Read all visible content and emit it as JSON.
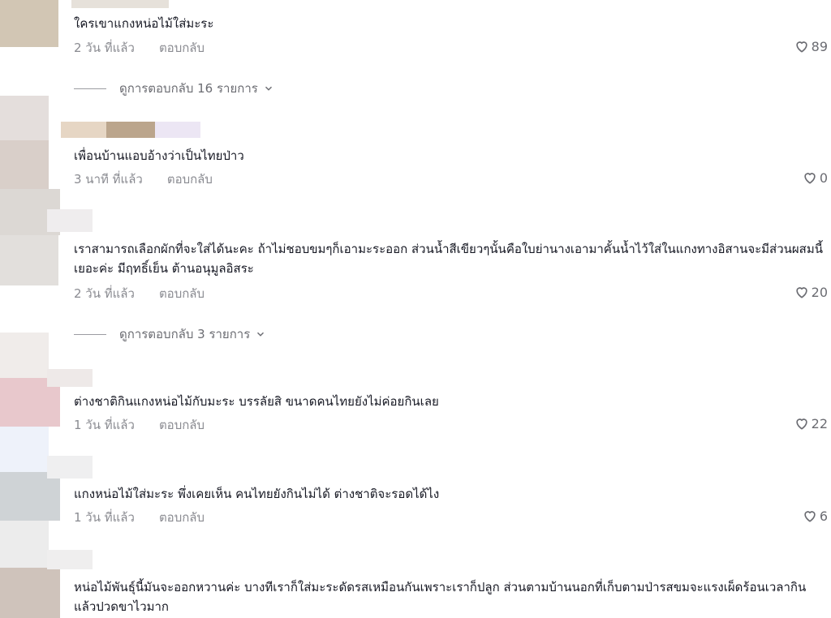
{
  "comments": [
    {
      "text": "ใครเขาแกงหน่อไม้ใส่มะระ",
      "time": "2 วัน ที่แล้ว",
      "reply": "ตอบกลับ",
      "likes": "89",
      "view_replies": "ดูการตอบกลับ 16 รายการ"
    },
    {
      "text": "เพื่อนบ้านแอบอ้างว่าเป็นไทยป่าว",
      "time": "3 นาที ที่แล้ว",
      "reply": "ตอบกลับ",
      "likes": "0"
    },
    {
      "text": "เราสามารถเลือกผักที่จะใส่ได้นะคะ ถ้าไม่ชอบขมๆก็เอามะระออก ส่วนน้ำสีเขียวๆนั้นคือใบย่านางเอามาคั้นน้ำไว้ใส่ในแกงทางอิสานจะมีส่วนผสมนี้เยอะค่ะ มีฤทธิ์เย็น ต้านอนุมูลอิสระ",
      "time": "2 วัน ที่แล้ว",
      "reply": "ตอบกลับ",
      "likes": "20",
      "view_replies": "ดูการตอบกลับ 3 รายการ"
    },
    {
      "text": "ต่างชาติกินแกงหน่อไม้กับมะระ บรรลัยสิ ขนาดคนไทยยังไม่ค่อยกินเลย",
      "time": "1 วัน ที่แล้ว",
      "reply": "ตอบกลับ",
      "likes": "22"
    },
    {
      "text": "แกงหน่อไม้ใส่มะระ พึ่งเคยเห็น คนไทยยังกินไม่ได้ ต่างชาติจะรอดได้ไง",
      "time": "1 วัน ที่แล้ว",
      "reply": "ตอบกลับ",
      "likes": "6"
    },
    {
      "text": "หน่อไม้พันธุ์นี้มันจะออกหวานค่ะ บางทีเราก็ใส่มะระดัดรสเหมือนกันเพราะเราก็ปลูก ส่วนตามบ้านนอกที่เก็บตามป่ารสขมจะแรงเผ็ดร้อนเวลากินแล้วปวดขาไวมาก"
    }
  ],
  "colors": {
    "text": "#161823",
    "secondary": "#8a8b91",
    "icon": "#6b6c72"
  },
  "icons": {
    "like": "heart-outline-icon",
    "expand": "chevron-down-icon"
  }
}
